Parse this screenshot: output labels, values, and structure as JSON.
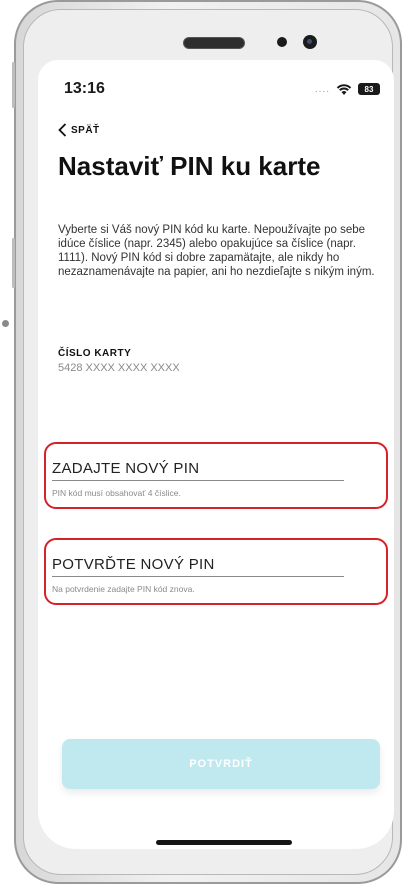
{
  "status_bar": {
    "time": "13:16",
    "signal": "....",
    "battery": "83"
  },
  "nav": {
    "back_label": "SPÄŤ"
  },
  "page": {
    "title": "Nastaviť PIN ku karte",
    "description": "Vyberte si Váš nový PIN kód ku karte. Nepoužívajte po sebe idúce číslice (napr. 2345) alebo opakujúce sa číslice (napr. 1111). Nový PIN kód si dobre zapamätajte, ale nikdy ho nezaznamenávajte na papier, ani ho nezdieľajte s nikým iným."
  },
  "card": {
    "label": "ČÍSLO KARTY",
    "number": "5428 XXXX XXXX XXXX"
  },
  "fields": {
    "new_pin": {
      "placeholder": "ZADAJTE NOVÝ PIN",
      "value": "",
      "hint": "PIN kód musí obsahovať 4 číslice."
    },
    "confirm_pin": {
      "placeholder": "POTVRĎTE NOVÝ PIN",
      "value": "",
      "hint": "Na potvrdenie zadajte PIN kód znova."
    }
  },
  "actions": {
    "confirm_label": "POTVRDIŤ"
  },
  "colors": {
    "highlight_border": "#d6202a",
    "button_disabled": "#bfe9ef",
    "text_primary": "#111111",
    "text_muted": "#8a8a8a"
  },
  "icons": {
    "back": "chevron-left-icon",
    "wifi": "wifi-icon",
    "battery": "battery-icon"
  }
}
